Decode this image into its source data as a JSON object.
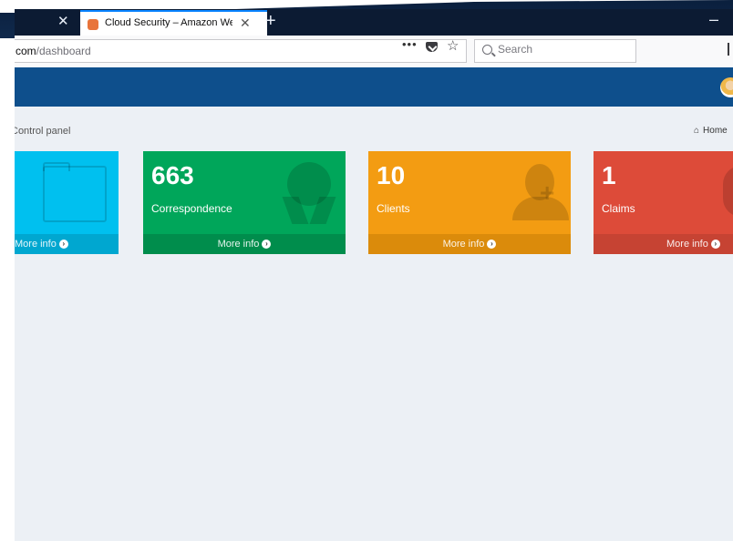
{
  "browser": {
    "active_tab_title": "Cloud Security – Amazon Web",
    "tab_close_glyph": "✕",
    "new_tab_glyph": "+",
    "minimize_glyph": "–",
    "url_host": "com",
    "url_path": "/dashboard",
    "page_actions_glyph": "•••",
    "star_glyph": "☆",
    "search_placeholder": "Search"
  },
  "page": {
    "breadcrumb_title": "Control panel",
    "home_label": "Home"
  },
  "stats": {
    "blue": {
      "value": "",
      "label": "",
      "footer": "More info"
    },
    "green": {
      "value": "663",
      "label": "Correspondence",
      "footer": "More info"
    },
    "orange": {
      "value": "10",
      "label": "Clients",
      "footer": "More info"
    },
    "red": {
      "value": "1",
      "label": "Claims",
      "footer": "More info"
    }
  },
  "icons": {
    "blue": "folder-icon",
    "green": "award-icon",
    "orange": "user-plus-icon",
    "red": "claims-icon"
  },
  "colors": {
    "header": "#0e4f8c",
    "blue": "#00c0ef",
    "green": "#00a65a",
    "orange": "#f39c12",
    "red": "#dd4b39",
    "content_bg": "#ecf0f5"
  }
}
